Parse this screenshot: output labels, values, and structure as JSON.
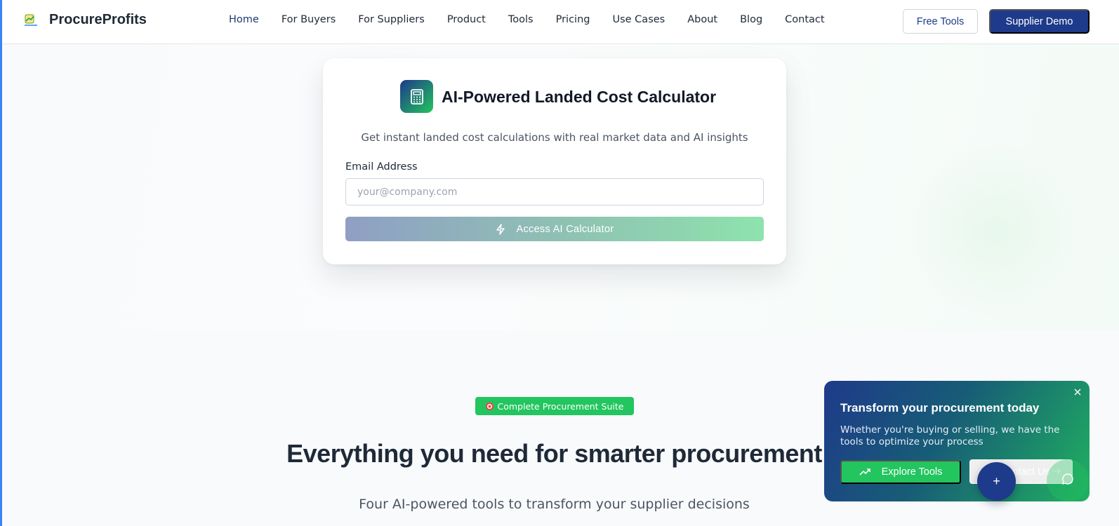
{
  "brand": {
    "name": "ProcureProfits",
    "logo_icon": "logo-icon"
  },
  "nav": {
    "links": [
      "Home",
      "For Buyers",
      "For Suppliers",
      "Product",
      "Tools",
      "Pricing",
      "Use Cases",
      "About",
      "Blog",
      "Contact"
    ],
    "active": "Home",
    "free_tools_label": "Free Tools",
    "demo_label": "Supplier Demo"
  },
  "calculator": {
    "icon": "calculator-icon",
    "title": "AI-Powered Landed Cost Calculator",
    "subtitle": "Get instant landed cost calculations with real market data and AI insights",
    "email_label": "Email Address",
    "email_placeholder": "your@company.com",
    "email_value": "",
    "button_label": "Access AI Calculator",
    "button_icon": "zap-icon"
  },
  "features": {
    "badge": "Complete Procurement Suite",
    "badge_icon": "target-icon",
    "title": "Everything you need for smarter procurement",
    "subtitle": "Four AI-powered tools to transform your supplier decisions"
  },
  "promo": {
    "title": "Transform your procurement today",
    "text": "Whether you're buying or selling, we have the tools to optimize your process",
    "explore_label": "Explore Tools",
    "contact_label": "Contact Us",
    "close_icon": "close-icon"
  },
  "fab": {
    "label": "+"
  },
  "colors": {
    "primary": "#1e3a8a",
    "accent_green": "#22c55e",
    "text": "#1f2937",
    "muted": "#4b5563"
  }
}
